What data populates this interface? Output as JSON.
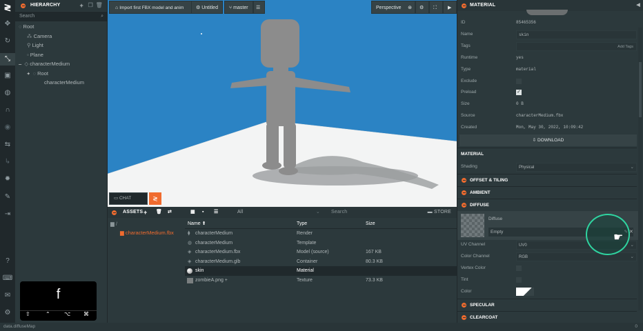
{
  "toolbar": {
    "icons": [
      "logo-icon",
      "move-icon",
      "rotate-icon",
      "scale-icon",
      "resize-icon",
      "world-icon",
      "magnet-icon",
      "eye-icon",
      "redo-icon",
      "undo-icon",
      "bulb-icon",
      "edit-icon",
      "publish-icon",
      "help-icon",
      "keyboard-icon",
      "feedback-icon",
      "settings-icon"
    ]
  },
  "hierarchy": {
    "title": "HIERARCHY",
    "search_placeholder": "Search",
    "items": [
      "Root",
      "Camera",
      "Light",
      "Plane",
      "characterMedium",
      "Root",
      "characterMedium"
    ]
  },
  "viewport": {
    "project_label": "Import first FBX model and anim",
    "scene_label": "Untitled",
    "branch_label": "master",
    "camera_label": "Perspective"
  },
  "chat": {
    "label": "CHAT"
  },
  "assets": {
    "title": "ASSETS",
    "filter": "All",
    "search_placeholder": "Search",
    "store_label": "STORE",
    "path": "/",
    "folder": "characterMedium.fbx",
    "columns": {
      "name": "Name",
      "type": "Type",
      "size": "Size"
    },
    "rows": [
      {
        "name": "characterMedium",
        "type": "Render",
        "size": ""
      },
      {
        "name": "characterMedium",
        "type": "Template",
        "size": ""
      },
      {
        "name": "characterMedium.fbx",
        "type": "Model (source)",
        "size": "167 KB"
      },
      {
        "name": "characterMedium.glb",
        "type": "Container",
        "size": "80.3 KB"
      },
      {
        "name": "skin",
        "type": "Material",
        "size": ""
      },
      {
        "name": "zombieA.png +",
        "type": "Texture",
        "size": "73.3 KB"
      }
    ]
  },
  "inspector": {
    "title": "MATERIAL",
    "fields": [
      {
        "label": "ID",
        "value": "85465356"
      },
      {
        "label": "Name",
        "value": "skin"
      },
      {
        "label": "Tags",
        "value": "",
        "extra": "Add Tags"
      },
      {
        "label": "Runtime",
        "value": "yes"
      },
      {
        "label": "Type",
        "value": "material"
      },
      {
        "label": "Exclude",
        "value": ""
      },
      {
        "label": "Preload",
        "value": ""
      },
      {
        "label": "Size",
        "value": "0 B"
      },
      {
        "label": "Source",
        "value": "characterMedium.fbx"
      },
      {
        "label": "Created",
        "value": "Mon, May 30, 2022, 10:09:42"
      }
    ],
    "download_label": "DOWNLOAD",
    "material_heading": "MATERIAL",
    "shading_label": "Shading",
    "shading_value": "Physical",
    "sections": [
      "OFFSET & TILING",
      "AMBIENT",
      "DIFFUSE"
    ],
    "diffuse_label": "Diffuse",
    "diffuse_value": "Empty",
    "uv_label": "UV Channel",
    "uv_value": "UV0",
    "color_channel_label": "Color Channel",
    "color_channel_value": "RGB",
    "vertex_color_label": "Vertex Color",
    "tint_label": "Tint",
    "color_label": "Color",
    "bottom_sections": [
      "SPECULAR",
      "CLEARCOAT"
    ]
  },
  "keyboard_overlay": {
    "key": "f"
  },
  "status": {
    "text": "data.diffuseMap",
    "count": "0"
  }
}
